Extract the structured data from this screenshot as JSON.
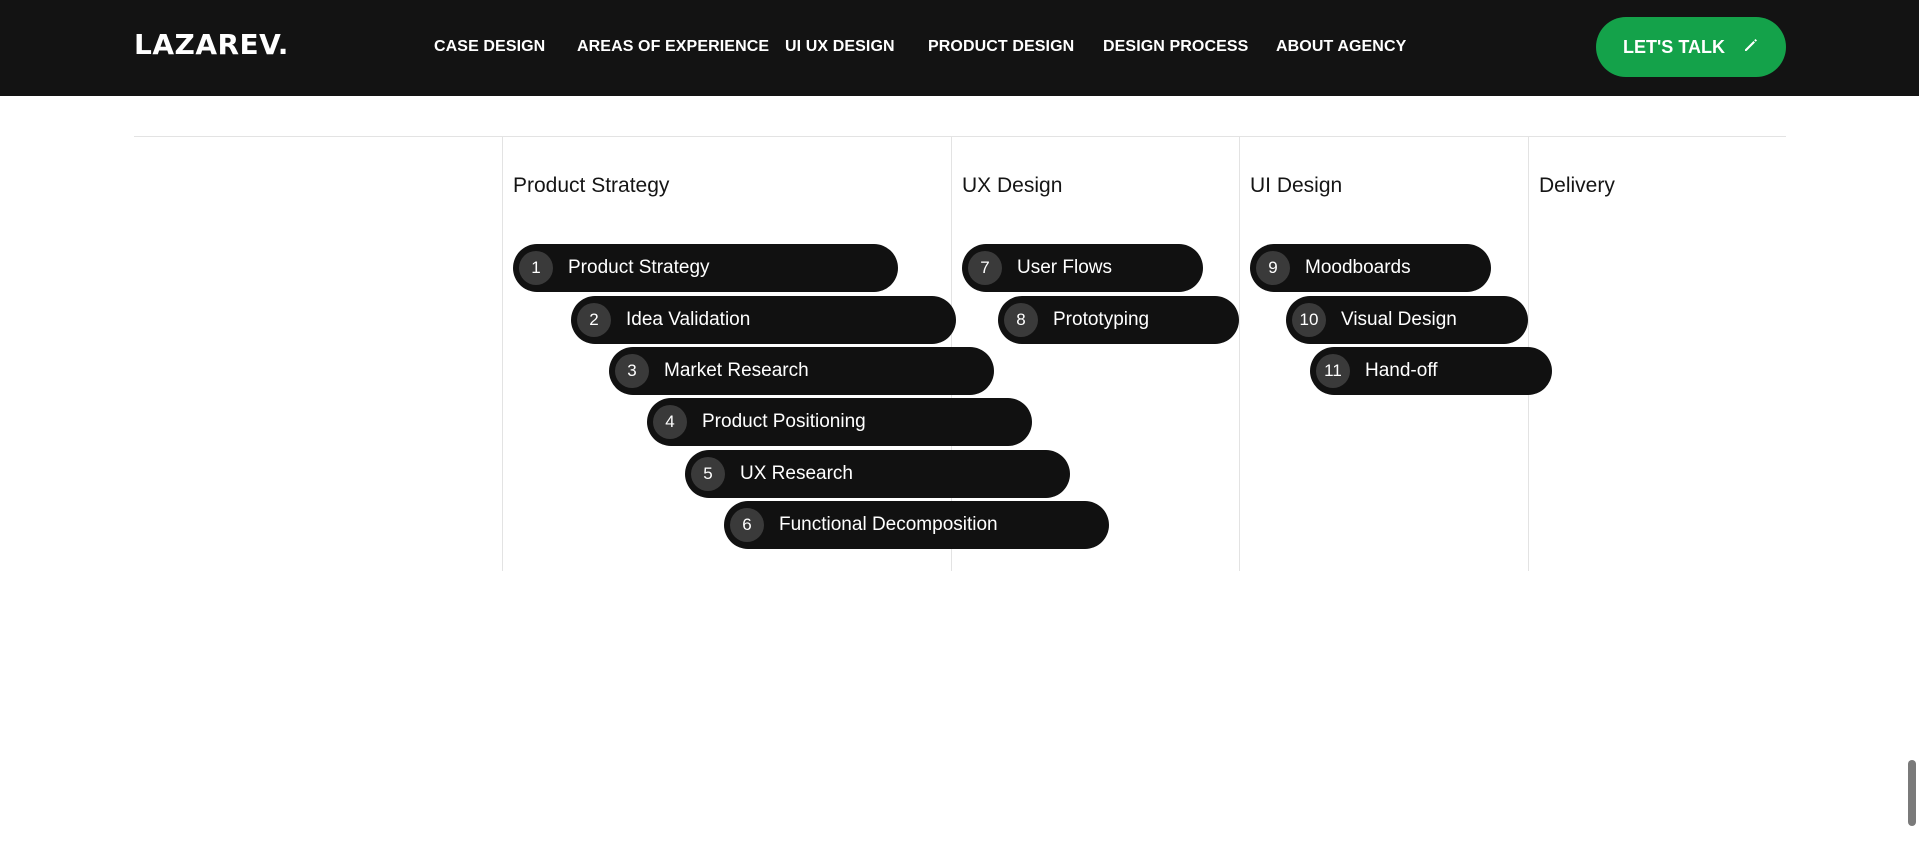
{
  "header": {
    "logo": "LAZAREV.",
    "nav": [
      "CASE DESIGN",
      "AREAS OF EXPERIENCE",
      "UI UX DESIGN",
      "PRODUCT DESIGN",
      "DESIGN PROCESS",
      "ABOUT AGENCY"
    ],
    "cta_label": "LET'S TALK",
    "cta_icon": "pencil-icon"
  },
  "colors": {
    "header_bg": "#131313",
    "cta_bg": "#14a24a",
    "pill_bg": "#111111",
    "badge_bg": "#3a3a3a"
  },
  "process": {
    "columns": [
      "Product Strategy",
      "UX Design",
      "UI Design",
      "Delivery"
    ],
    "steps": [
      {
        "num": "1",
        "label": "Product Strategy"
      },
      {
        "num": "2",
        "label": "Idea Validation"
      },
      {
        "num": "3",
        "label": "Market Research"
      },
      {
        "num": "4",
        "label": "Product Positioning"
      },
      {
        "num": "5",
        "label": "UX Research"
      },
      {
        "num": "6",
        "label": "Functional Decomposition"
      },
      {
        "num": "7",
        "label": "User Flows"
      },
      {
        "num": "8",
        "label": "Prototyping"
      },
      {
        "num": "9",
        "label": "Moodboards"
      },
      {
        "num": "10",
        "label": "Visual Design"
      },
      {
        "num": "11",
        "label": "Hand-off"
      }
    ]
  }
}
